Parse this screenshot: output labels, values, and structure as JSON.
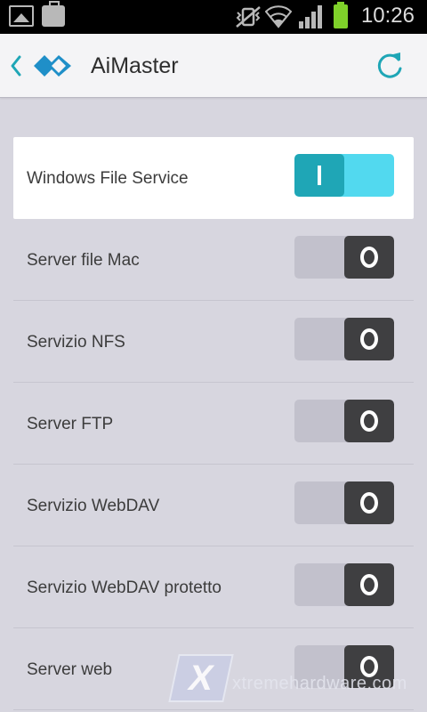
{
  "status_bar": {
    "time": "10:26",
    "icons": [
      "image-icon",
      "briefcase-icon",
      "vibrate-mute-icon",
      "wifi-icon",
      "signal-icon",
      "battery-icon"
    ],
    "battery_color": "#7fd12a"
  },
  "action_bar": {
    "title": "AiMaster",
    "accent": "#1fa6b6"
  },
  "services": [
    {
      "label": "Windows File Service",
      "state": "on",
      "state_glyph": "I"
    },
    {
      "label": "Server file Mac",
      "state": "off",
      "state_glyph": "O"
    },
    {
      "label": "Servizio NFS",
      "state": "off",
      "state_glyph": "O"
    },
    {
      "label": "Server FTP",
      "state": "off",
      "state_glyph": "O"
    },
    {
      "label": "Servizio WebDAV",
      "state": "off",
      "state_glyph": "O"
    },
    {
      "label": "Servizio WebDAV protetto",
      "state": "off",
      "state_glyph": "O"
    },
    {
      "label": "Server web",
      "state": "off",
      "state_glyph": "O"
    }
  ],
  "watermark": {
    "text": "xtremehardware.com",
    "logo_glyph": "X"
  }
}
